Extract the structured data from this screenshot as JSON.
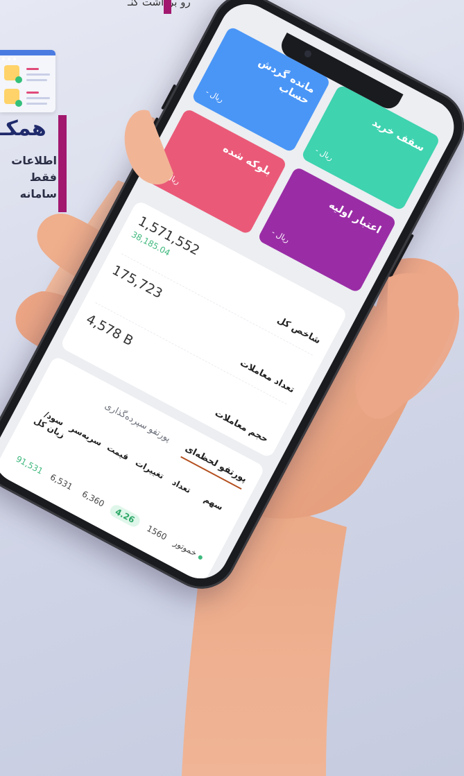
{
  "promo": {
    "top_text": "رو برداشت کنـ",
    "heading": "همکـ",
    "lines": [
      "اطلاعات",
      "فقط",
      "سامانه"
    ]
  },
  "cards": [
    {
      "title": "سقف خرید",
      "value": "ریال -",
      "color": "#3fd3b0"
    },
    {
      "title": "مانده گردش حساب",
      "value": "ریال -",
      "color": "#4a96f7"
    },
    {
      "title": "اعتبار اولیه",
      "value": "ریال -",
      "color": "#9a2da6"
    },
    {
      "title": "بلوکه شده",
      "value": "ریال -",
      "color": "#ea5a78"
    }
  ],
  "stats": [
    {
      "label": "شاخص کل",
      "value": "1,571,552",
      "sub": "38,185.04"
    },
    {
      "label": "تعداد معاملات",
      "value": "175,723",
      "sub": ""
    },
    {
      "label": "حجم معاملات",
      "value": "4,578 B",
      "sub": ""
    }
  ],
  "portfolio": {
    "tabs": [
      "پورتفو لحظه‌ای",
      "پورتفو سپرده‌گذاری"
    ],
    "columns": [
      "سهم",
      "تعداد",
      "تغییرات",
      "قیمت",
      "سربه‌سر",
      "سود/ زیان کل"
    ],
    "rows": [
      {
        "symbol": "خموتور",
        "count": "1560",
        "change": "4.26",
        "price": "6,360",
        "breakeven": "6,531",
        "pnl": "91,531"
      }
    ]
  }
}
